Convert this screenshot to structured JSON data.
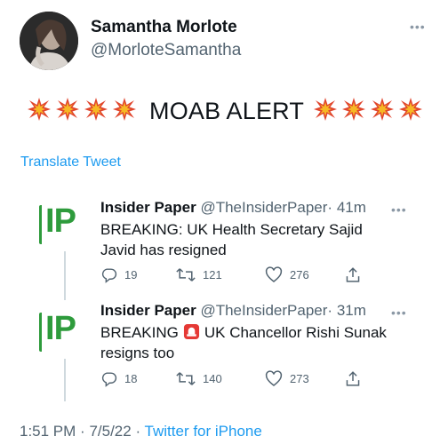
{
  "author": {
    "display_name": "Samantha Morlote",
    "handle": "@MorloteSamantha"
  },
  "more_label": "•••",
  "tweet": {
    "text": "MOAB ALERT",
    "emoji_name": "collision",
    "emoji_count_each_side": 4,
    "translate_label": "Translate Tweet"
  },
  "quoted_tweets": [
    {
      "name": "Insider Paper",
      "handle": "@TheInsiderPaper",
      "separator": "·",
      "time": "41m",
      "text_line1": "BREAKING: UK Health Secretary Sajid",
      "text_line2": "Javid has resigned",
      "replies": "19",
      "retweets": "121",
      "likes": "276"
    },
    {
      "name": "Insider Paper",
      "handle": "@TheInsiderPaper",
      "separator": "·",
      "time": "31m",
      "text_before_emoji": "BREAKING",
      "emoji_name": "police-car-light",
      "text_after_emoji": "UK Chancellor Rishi Sunak",
      "text_line2": "resigns too",
      "replies": "18",
      "retweets": "140",
      "likes": "273"
    }
  ],
  "footer": {
    "time": "1:51 PM",
    "separator": "·",
    "date": "7/5/22",
    "source": "Twitter for iPhone"
  },
  "colors": {
    "accent": "#1d9bf0",
    "secondary_text": "#536471",
    "logo_green": "#2e9b3c"
  }
}
